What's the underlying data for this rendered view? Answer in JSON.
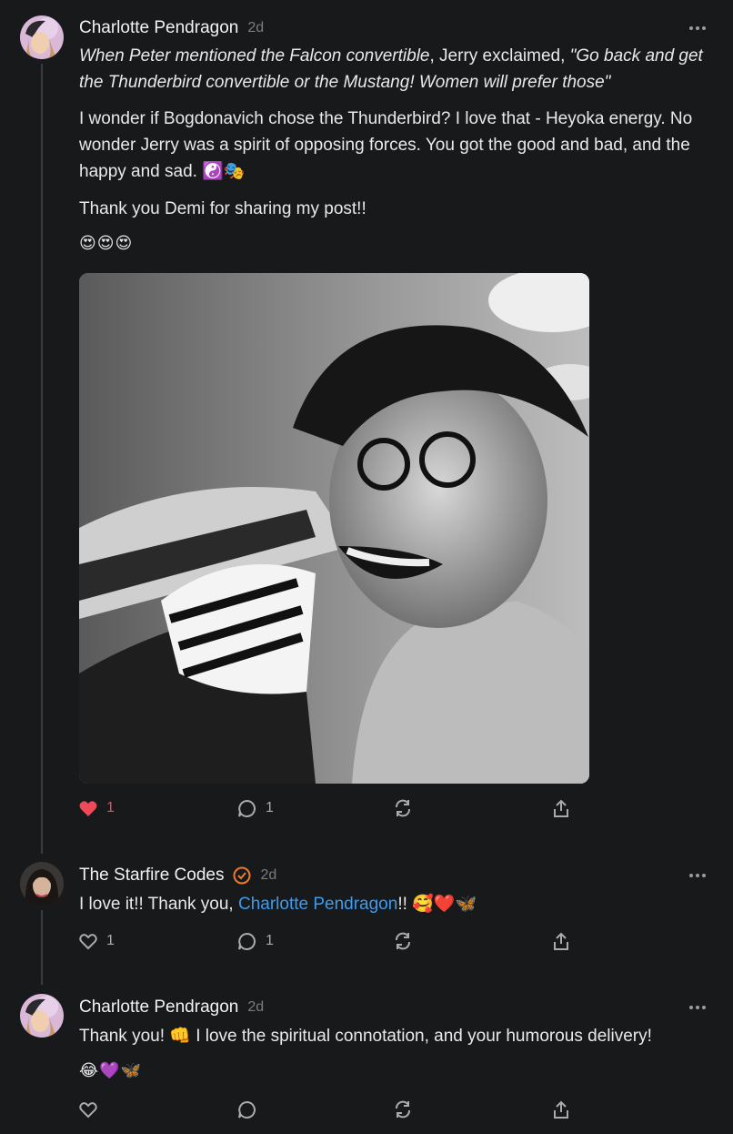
{
  "comments": [
    {
      "author": "Charlotte Pendragon",
      "time": "2d",
      "p1_italic_a": "When Peter mentioned the Falcon convertible",
      "p1_normal_a": ", Jerry exclaimed, ",
      "p1_italic_b": "\"Go back and get the Thunderbird convertible or the Mustang! Women will prefer those\"",
      "p2": "I wonder if Bogdonavich chose the Thunderbird? I love that - Heyoka energy. No wonder Jerry was a spirit of opposing forces. You got the good and bad, and the happy and sad. ☯️🎭",
      "p3": "Thank you Demi for sharing my post!!",
      "emojis": "😍😍😍",
      "likes": "1",
      "replies": "1"
    },
    {
      "author": "The Starfire Codes",
      "time": "2d",
      "text_before": "I love it!! Thank you, ",
      "mention": "Charlotte Pendragon",
      "text_after": "!! 🥰❤️🦋",
      "likes": "1",
      "replies": "1"
    },
    {
      "author": "Charlotte Pendragon",
      "time": "2d",
      "text": "Thank you! 👊 I love the spiritual connotation, and your humorous delivery!",
      "emojis": "😂💜🦋"
    }
  ],
  "colors": {
    "background": "#17191b",
    "like_active": "#ee4a5a",
    "mention": "#3b9cf0",
    "verified": "#f07a2a"
  },
  "icons": [
    "heart-icon",
    "comment-icon",
    "restack-icon",
    "share-icon",
    "more-icon",
    "verified-icon"
  ]
}
